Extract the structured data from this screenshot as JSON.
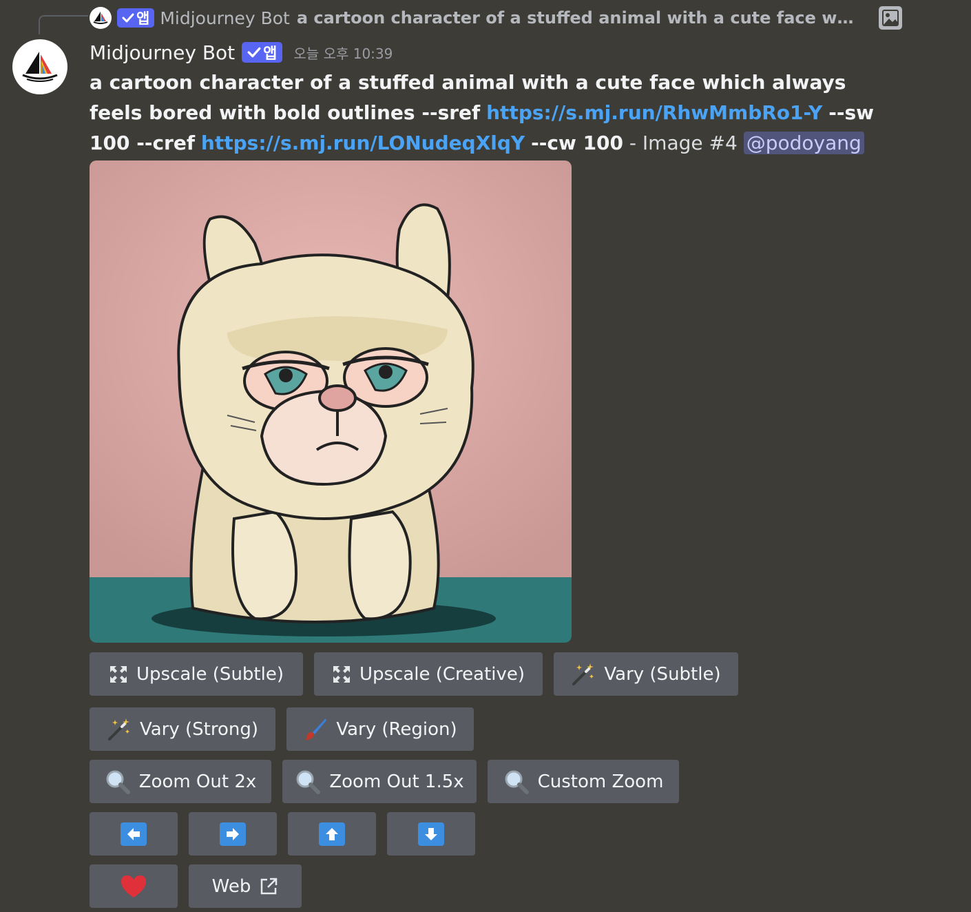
{
  "reply": {
    "app_badge": "앱",
    "author": "Midjourney Bot",
    "text": "a cartoon character of a stuffed animal with a cute face which al..."
  },
  "message": {
    "author": "Midjourney Bot",
    "app_badge": "앱",
    "timestamp": "오늘 오후 10:39",
    "prompt_part1": "a cartoon character of a stuffed animal with a cute face which always feels bored with bold outlines --sref",
    "sref_link": "https://s.mj.run/RhwMmbRo1-Y",
    "prompt_part2": "--sw 100 --cref",
    "cref_link": "https://s.mj.run/LONudeqXlqY",
    "prompt_part3": "--cw 100",
    "image_label": "- Image #4",
    "mention": "@podoyang"
  },
  "buttons": {
    "upscale_subtle": "Upscale (Subtle)",
    "upscale_creative": "Upscale (Creative)",
    "vary_subtle": "Vary (Subtle)",
    "vary_strong": "Vary (Strong)",
    "vary_region": "Vary (Region)",
    "zoom_out_2x": "Zoom Out 2x",
    "zoom_out_1_5x": "Zoom Out 1.5x",
    "custom_zoom": "Custom Zoom",
    "web": "Web"
  },
  "icons": {
    "upscale": "expand-arrows-icon",
    "vary": "magic-wand-icon",
    "region": "paintbrush-icon",
    "zoom": "magnifier-icon",
    "pan_left": "arrow-left-icon",
    "pan_right": "arrow-right-icon",
    "pan_up": "arrow-up-icon",
    "pan_down": "arrow-down-icon",
    "favorite": "heart-icon",
    "external": "external-link-icon"
  },
  "colors": {
    "background": "#3e3c37",
    "button": "#585b61",
    "badge": "#5865f2",
    "link": "#4aa3f5",
    "mention_bg": "#51557c",
    "arrow": "#3b8ee0",
    "heart": "#e0303a"
  }
}
